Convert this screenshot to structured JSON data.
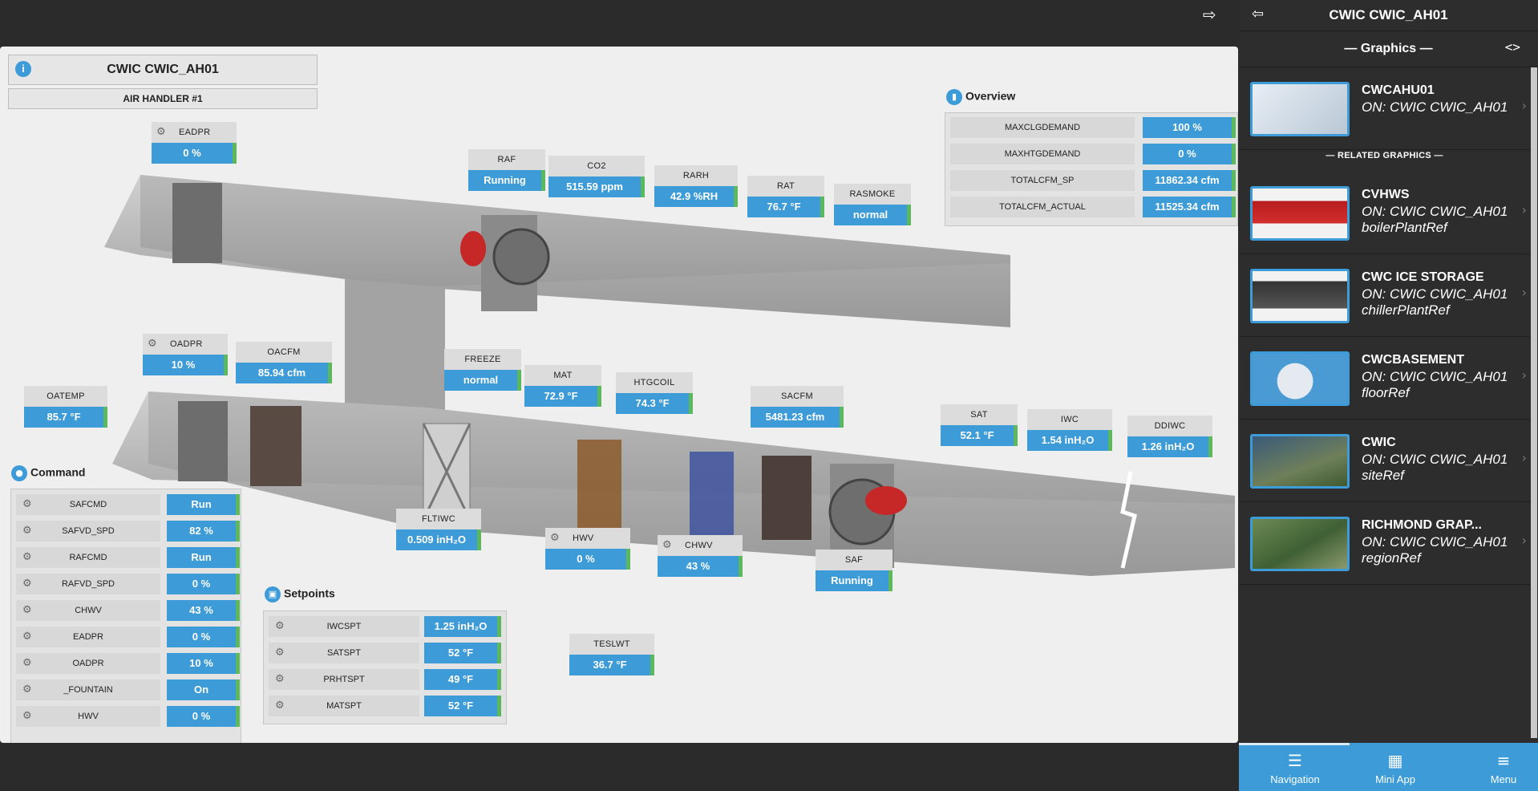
{
  "header": {
    "title": "CWIC CWIC_AH01",
    "subtitle": "AIR HANDLER #1"
  },
  "points": {
    "eadpr": {
      "label": "EADPR",
      "value": "0 %"
    },
    "raf": {
      "label": "RAF",
      "value": "Running"
    },
    "co2": {
      "label": "CO2",
      "value": "515.59 ppm"
    },
    "rarh": {
      "label": "RARH",
      "value": "42.9 %RH"
    },
    "rat": {
      "label": "RAT",
      "value": "76.7 °F"
    },
    "rasmoke": {
      "label": "RASMOKE",
      "value": "normal"
    },
    "oadpr": {
      "label": "OADPR",
      "value": "10 %"
    },
    "oacfm": {
      "label": "OACFM",
      "value": "85.94 cfm"
    },
    "oatemp": {
      "label": "OATEMP",
      "value": "85.7 °F"
    },
    "freeze": {
      "label": "FREEZE",
      "value": "normal"
    },
    "mat": {
      "label": "MAT",
      "value": "72.9 °F"
    },
    "htgcoil": {
      "label": "HTGCOIL",
      "value": "74.3 °F"
    },
    "sacfm": {
      "label": "SACFM",
      "value": "5481.23 cfm"
    },
    "sat": {
      "label": "SAT",
      "value": "52.1 °F"
    },
    "iwc": {
      "label": "IWC",
      "value": "1.54 inH₂O"
    },
    "ddiwc": {
      "label": "DDIWC",
      "value": "1.26 inH₂O"
    },
    "fltiwc": {
      "label": "FLTIWC",
      "value": "0.509 inH₂O"
    },
    "hwv": {
      "label": "HWV",
      "value": "0 %"
    },
    "chwv": {
      "label": "CHWV",
      "value": "43 %"
    },
    "saf": {
      "label": "SAF",
      "value": "Running"
    },
    "teslwt": {
      "label": "TESLWT",
      "value": "36.7 °F"
    }
  },
  "overview": {
    "title": "Overview",
    "rows": [
      {
        "name": "MAXCLGDEMAND",
        "value": "100 %"
      },
      {
        "name": "MAXHTGDEMAND",
        "value": "0 %"
      },
      {
        "name": "TOTALCFM_SP",
        "value": "11862.34 cfm"
      },
      {
        "name": "TOTALCFM_ACTUAL",
        "value": "11525.34 cfm"
      }
    ]
  },
  "command": {
    "title": "Command",
    "rows": [
      {
        "name": "SAFCMD",
        "value": "Run"
      },
      {
        "name": "SAFVD_SPD",
        "value": "82 %"
      },
      {
        "name": "RAFCMD",
        "value": "Run"
      },
      {
        "name": "RAFVD_SPD",
        "value": "0 %"
      },
      {
        "name": "CHWV",
        "value": "43 %"
      },
      {
        "name": "EADPR",
        "value": "0 %"
      },
      {
        "name": "OADPR",
        "value": "10 %"
      },
      {
        "name": "_FOUNTAIN",
        "value": "On"
      },
      {
        "name": "HWV",
        "value": "0 %"
      }
    ]
  },
  "setpoints": {
    "title": "Setpoints",
    "rows": [
      {
        "name": "IWCSPT",
        "value": "1.25 inH₂O"
      },
      {
        "name": "SATSPT",
        "value": "52 °F"
      },
      {
        "name": "PRHTSPT",
        "value": "49 °F"
      },
      {
        "name": "MATSPT",
        "value": "52 °F"
      }
    ]
  },
  "sidebar": {
    "title": "CWIC CWIC_AH01",
    "graphics_title": "— Graphics —",
    "related_title": "— RELATED GRAPHICS —",
    "current": {
      "name": "CWCAHU01",
      "line2": "ON: CWIC CWIC_AH01"
    },
    "related": [
      {
        "name": "CVHWS",
        "line2": "ON: CWIC CWIC_AH01",
        "line3": "boilerPlantRef"
      },
      {
        "name": "CWC ICE STORAGE",
        "line2": "ON: CWIC CWIC_AH01",
        "line3": "chillerPlantRef"
      },
      {
        "name": "CWCBASEMENT",
        "line2": "ON: CWIC CWIC_AH01",
        "line3": "floorRef"
      },
      {
        "name": "CWIC",
        "line2": "ON: CWIC CWIC_AH01",
        "line3": "siteRef"
      },
      {
        "name": "RICHMOND GRAP...",
        "line2": "ON: CWIC CWIC_AH01",
        "line3": "regionRef"
      }
    ],
    "nav": {
      "navigation": "Navigation",
      "mini_app": "Mini App",
      "menu": "Menu"
    }
  },
  "colors": {
    "accent": "#3d9bd7",
    "ok": "#5cb85c",
    "background": "#2b2b2b",
    "canvas": "#efefef"
  }
}
